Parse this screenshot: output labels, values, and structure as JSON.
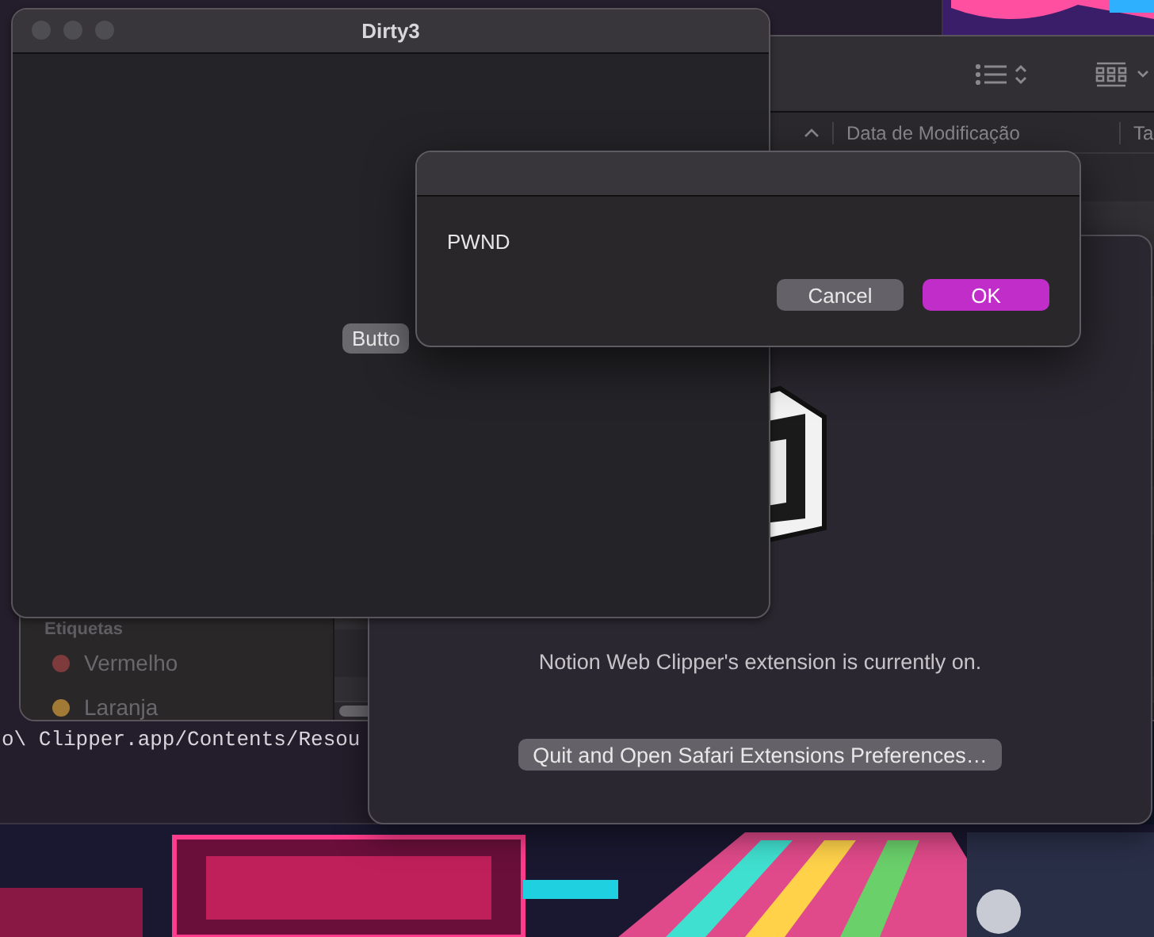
{
  "terminal": {
    "lines": [
      "o\\ Clipper.app/Contents/Resou"
    ]
  },
  "finder": {
    "columns": [
      "Data de Modificação",
      "Ta"
    ],
    "sidebar": {
      "section": "Etiquetas",
      "tags": [
        {
          "label": "Vermelho",
          "color": "#7d3b3b"
        },
        {
          "label": "Laranja",
          "color": "#a17a35"
        }
      ]
    }
  },
  "notion": {
    "status": "Notion Web Clipper's extension is currently on.",
    "button": "Quit and Open Safari Extensions Preferences…"
  },
  "dirty3": {
    "title": "Dirty3",
    "button": "Butto"
  },
  "alert": {
    "message": "PWND",
    "buttons": [
      {
        "label": "Cancel",
        "default": false
      },
      {
        "label": "OK",
        "default": true
      }
    ]
  }
}
